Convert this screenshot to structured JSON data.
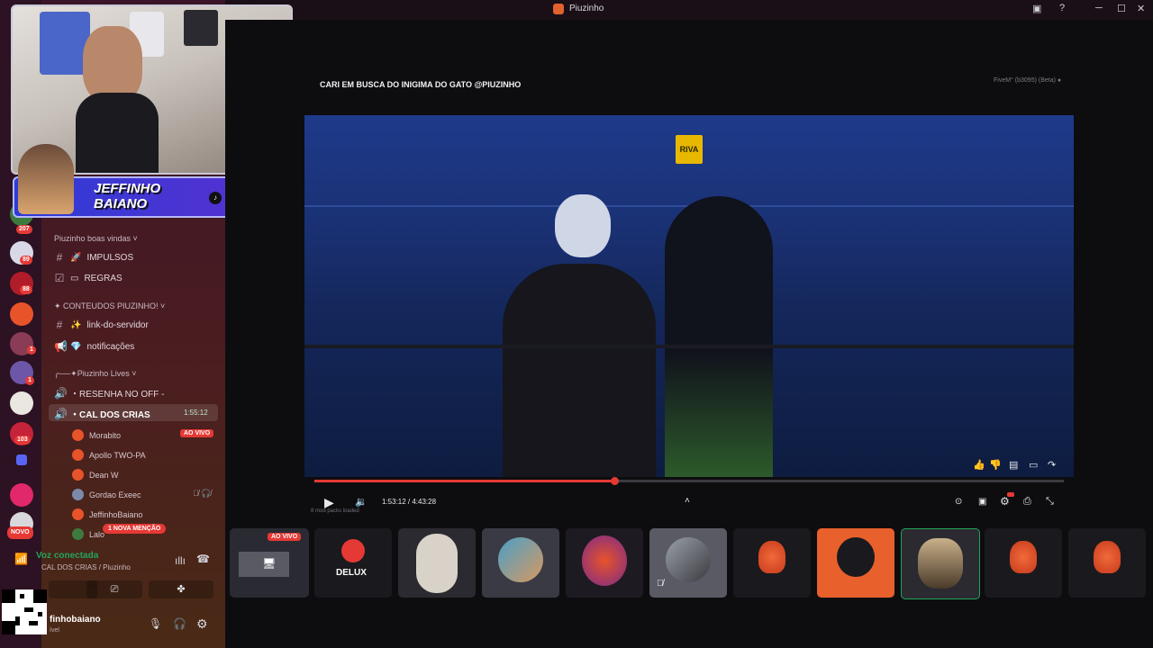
{
  "window": {
    "title": "Piuzinho",
    "controls": {
      "minimize": "─",
      "maximize": "☐",
      "close": "✕"
    }
  },
  "servers": {
    "badges": [
      "207",
      "89",
      "88",
      "1",
      "1",
      "1",
      "103"
    ],
    "new_label": "NOVO"
  },
  "channels": {
    "categories": {
      "welcome": "Piuzinho boas vindas ˅",
      "content": "✦ CONTEUDOS PIUZINHO! ˅",
      "lives": "╭──✦Piuzinho Lives ˅"
    },
    "impulsos": "IMPULSOS",
    "regras": "REGRAS",
    "link_servidor": "link-do-servidor",
    "notificacoes": "notificações",
    "resenha": "・RESENHA NO OFF -",
    "cal_dos_crias": "・CAL DOS CRIAS",
    "cal_timer": "1:55:12",
    "voice_users": [
      "Morabito",
      "Apollo TWO-PA",
      "Dean W",
      "Gordao Exeec",
      "JeffinhoBaiano",
      "Lalo"
    ],
    "live_badge": "AO VIVO",
    "mention_badge": "1 NOVA MENÇÃO"
  },
  "streamer_banner": {
    "name_line1": "JEFFINHO",
    "name_line2": "BAIANO"
  },
  "voice_status": {
    "title": "Voz conectada",
    "subtitle": "CAL DOS CRIAS / Piuzinho"
  },
  "user_panel": {
    "username": "finhobaiano",
    "status": "ível"
  },
  "stream": {
    "title": "CARI EM BUSCA DO INIGIMA DO GATO @PIUZINHO",
    "build": "FiveM° (b3095) (Beta) ●",
    "time": "1:53:12 / 4:43:28",
    "progress_fraction": 0.4,
    "mods_text": "8 mod packs loaded",
    "video_logo": "RIVA"
  },
  "participants": {
    "live_badge": "AO VIVO",
    "tiles": [
      "screen-share",
      "delux",
      "mask",
      "avatar-cap",
      "fire-skull-neon",
      "avatar-bw",
      "fire-skull",
      "fire-skull-orange",
      "avatar-man",
      "fire-skull",
      "fire-skull"
    ],
    "delux_label": "DELUX"
  },
  "colors": {
    "accent_red": "#e53935",
    "brand_orange": "#e8532a",
    "voice_green": "#23a55a"
  }
}
